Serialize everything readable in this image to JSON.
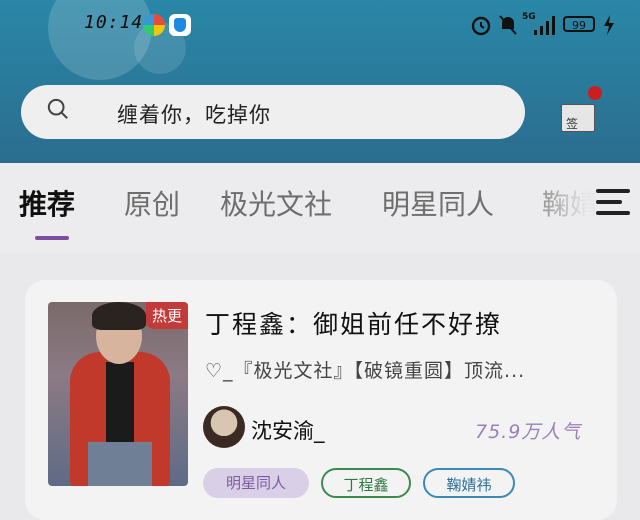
{
  "status_bar": {
    "time": "10:14",
    "battery": "99",
    "network": "5G"
  },
  "search": {
    "placeholder": "缠着你，吃掉你"
  },
  "checkin": {
    "label": "签"
  },
  "tabs": [
    {
      "label": "推荐",
      "active": true
    },
    {
      "label": "原创",
      "active": false
    },
    {
      "label": "极光文社",
      "active": false
    },
    {
      "label": "明星同人",
      "active": false
    },
    {
      "label": "鞠婧",
      "active": false
    }
  ],
  "book": {
    "badge": "热更",
    "title": "丁程鑫：御姐前任不好撩",
    "description": "♡_『极光文社』【破镜重圆】顶流...",
    "author": "沈安渝_",
    "popularity": "75.9万人气",
    "tags": [
      "明星同人",
      "丁程鑫",
      "鞠婧祎"
    ]
  },
  "colors": {
    "header": "#2a87a7",
    "active_tab_underline": "#7b4fa0",
    "hot_badge": "#c33a3a",
    "popularity_text": "#9a80b8"
  }
}
